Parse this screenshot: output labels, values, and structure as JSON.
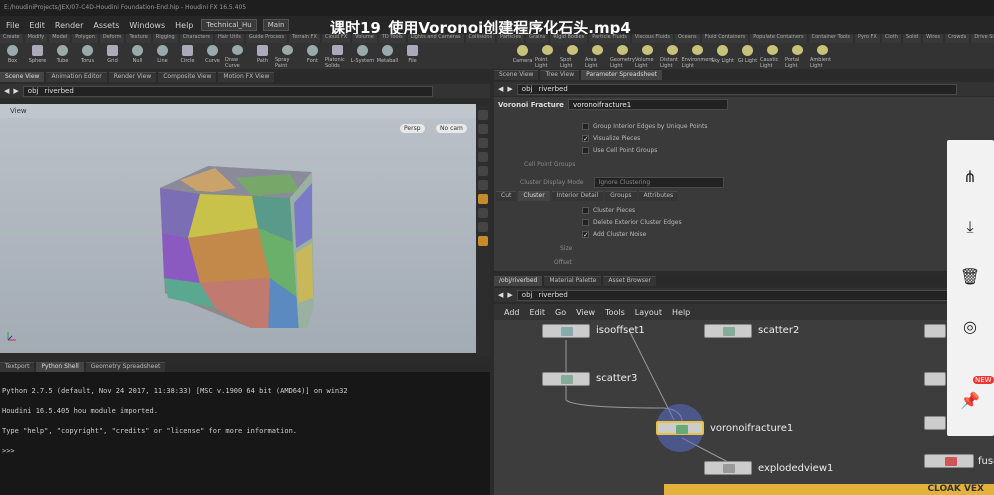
{
  "titlebar": {
    "text": "E:/houdiniProjects/JEX/07-C4D-Houdini Foundation-End.hip - Houdini FX 16.5.405"
  },
  "menubar": {
    "items": [
      "File",
      "Edit",
      "Render",
      "Assets",
      "Windows",
      "Help"
    ],
    "desktop": "Technical_Hu",
    "main": "Main"
  },
  "video_title": "课时19_使用Voronoi创建程序化石头.mp4",
  "shelf_tabs": [
    "Create",
    "Modify",
    "Model",
    "Polygon",
    "Deform",
    "Texture",
    "Rigging",
    "Characters",
    "Hair Utils",
    "Guide Process",
    "Terrain FX",
    "Cloud FX",
    "Volume",
    "TD Tools",
    "Lights and Cameras",
    "Collisions",
    "Particles",
    "Grains",
    "Rigid Bodies",
    "Particle Fluids",
    "Viscous Fluids",
    "Oceans",
    "Fluid Containers",
    "Populate Containers",
    "Container Tools",
    "Pyro FX",
    "Cloth",
    "Solid",
    "Wires",
    "Crowds",
    "Drive Simulation"
  ],
  "shelf_left": [
    "Box",
    "Sphere",
    "Tube",
    "Torus",
    "Grid",
    "Null",
    "Line",
    "Circle",
    "Curve",
    "Draw Curve",
    "Path",
    "Spray Paint",
    "Font",
    "Platonic Solids",
    "L-System",
    "Metaball",
    "File"
  ],
  "shelf_right": [
    "Camera",
    "Point Light",
    "Spot Light",
    "Area Light",
    "Geometry Light",
    "Volume Light",
    "Distant Light",
    "Environment Light",
    "Sky Light",
    "GI Light",
    "Caustic Light",
    "Portal Light",
    "Ambient Light"
  ],
  "left_tabs": [
    "Scene View",
    "Animation Editor",
    "Render View",
    "Composite View",
    "Motion FX View"
  ],
  "left_path": {
    "obj": "obj",
    "node": "riverbed"
  },
  "view_label": "View",
  "viewport_buttons": [
    "Persp",
    "No cam"
  ],
  "right_tabs": [
    "Scene View",
    "Tree View",
    "Parameter Spreadsheet"
  ],
  "right_path": {
    "obj": "obj",
    "node": "riverbed"
  },
  "param": {
    "type": "Voronoi Fracture",
    "name": "voronoifracture1",
    "rows": [
      {
        "label": "Group Interior Edges by Unique Points",
        "checked": false
      },
      {
        "label": "Visualize Pieces",
        "checked": true
      },
      {
        "label": "Use Cell Point Groups",
        "checked": false
      }
    ],
    "cell_point_groups": "Cell Point Groups",
    "cluster_display_mode": "Cluster Display Mode",
    "cluster_value": "Ignore Clustering",
    "tabs": [
      "Cut",
      "Cluster",
      "Interior Detail",
      "Groups",
      "Attributes"
    ],
    "cluster_rows": [
      {
        "label": "Cluster Pieces",
        "checked": false
      },
      {
        "label": "Delete Exterior Cluster Edges",
        "checked": false
      },
      {
        "label": "Add Cluster Noise",
        "checked": true
      }
    ],
    "size_label": "Size",
    "offset_label": "Offset"
  },
  "console": {
    "tabs": [
      "Textport",
      "Python Shell",
      "Geometry Spreadsheet"
    ],
    "lines": [
      "Python 2.7.5 (default, Nov 24 2017, 11:38:33) [MSC v.1900 64 bit (AMD64)] on win32",
      "Houdini 16.5.405 hou module imported.",
      "Type \"help\", \"copyright\", \"credits\" or \"license\" for more information.",
      ">>>"
    ]
  },
  "network": {
    "tabs": [
      "/obj/riverbed",
      "Material Palette",
      "Asset Browser"
    ],
    "path": {
      "obj": "obj",
      "node": "riverbed"
    },
    "menu": [
      "Add",
      "Edit",
      "Go",
      "View",
      "Tools",
      "Layout",
      "Help"
    ],
    "nodes": [
      "isooffset1",
      "scatter2",
      "scatter3",
      "voronoifracture1",
      "explodedview1",
      "fuse"
    ]
  },
  "side_panel": {
    "icons": [
      "share-icon",
      "download-icon",
      "delete-icon",
      "target-icon",
      "pin-icon"
    ],
    "badge": "NEW"
  },
  "watermark": "CLOAK VEX"
}
